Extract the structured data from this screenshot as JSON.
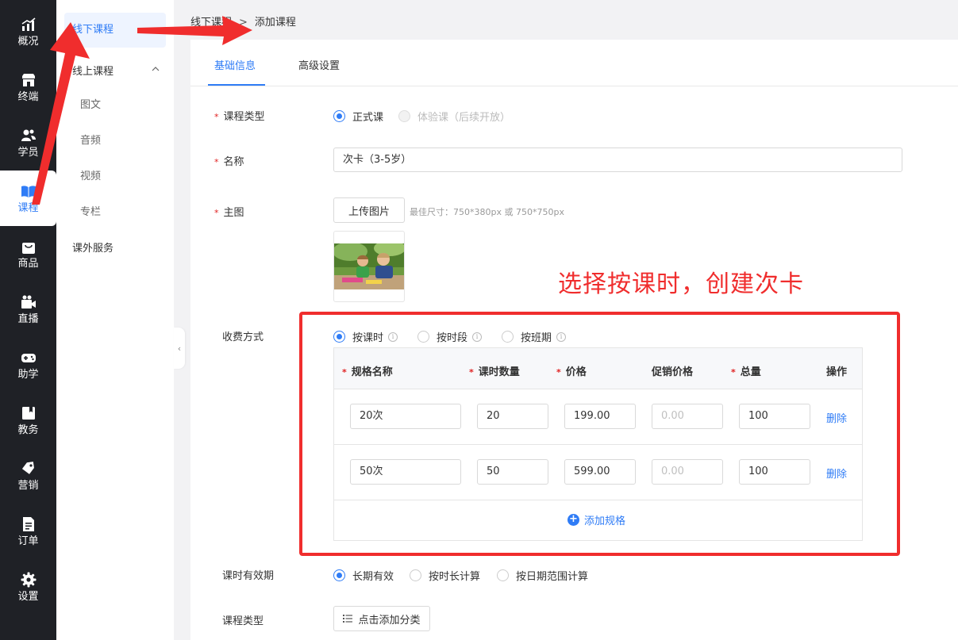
{
  "rail": {
    "items": [
      {
        "label": "概况",
        "icon": "chart-trend-icon"
      },
      {
        "label": "终端",
        "icon": "store-icon"
      },
      {
        "label": "学员",
        "icon": "users-icon"
      },
      {
        "label": "课程",
        "icon": "book-icon",
        "active": true
      },
      {
        "label": "商品",
        "icon": "shopping-bag-icon"
      },
      {
        "label": "直播",
        "icon": "video-camera-icon"
      },
      {
        "label": "助学",
        "icon": "gamepad-icon"
      },
      {
        "label": "教务",
        "icon": "folder-icon"
      },
      {
        "label": "营销",
        "icon": "tag-icon"
      },
      {
        "label": "订单",
        "icon": "document-icon"
      },
      {
        "label": "设置",
        "icon": "gear-icon"
      }
    ]
  },
  "subnav": {
    "offline": "线下课程",
    "online": "线上课程",
    "children": [
      "图文",
      "音频",
      "视频",
      "专栏"
    ],
    "extra": "课外服务"
  },
  "breadcrumb": {
    "parent": "线下课程",
    "separator": ">",
    "current": "添加课程"
  },
  "tabs": {
    "basic": "基础信息",
    "advanced": "高级设置"
  },
  "form": {
    "course_type": {
      "label": "课程类型",
      "options": [
        "正式课",
        "体验课（后续开放）"
      ]
    },
    "name": {
      "label": "名称",
      "value": "次卡（3-5岁）"
    },
    "main_image": {
      "label": "主图",
      "upload_button": "上传图片",
      "hint": "最佳尺寸：750*380px 或 750*750px"
    },
    "charge": {
      "label": "收费方式",
      "options": [
        "按课时",
        "按时段",
        "按班期"
      ]
    },
    "spec_table": {
      "headers": [
        "规格名称",
        "课时数量",
        "价格",
        "促销价格",
        "总量",
        "操作"
      ],
      "rows": [
        {
          "name": "20次",
          "count": "20",
          "price": "199.00",
          "promo": "0.00",
          "total": "100",
          "action": "删除"
        },
        {
          "name": "50次",
          "count": "50",
          "price": "599.00",
          "promo": "0.00",
          "total": "100",
          "action": "删除"
        }
      ],
      "add_label": "添加规格"
    },
    "validity": {
      "label": "课时有效期",
      "options": [
        "长期有效",
        "按时长计算",
        "按日期范围计算"
      ]
    },
    "category": {
      "label": "课程类型",
      "button": "点击添加分类"
    }
  },
  "annotation": {
    "text": "选择按课时，创建次卡",
    "color": "#f02d2d"
  },
  "colors": {
    "accent": "#2f7cf6",
    "rail_bg": "#1f2126",
    "required": "#e02020"
  }
}
